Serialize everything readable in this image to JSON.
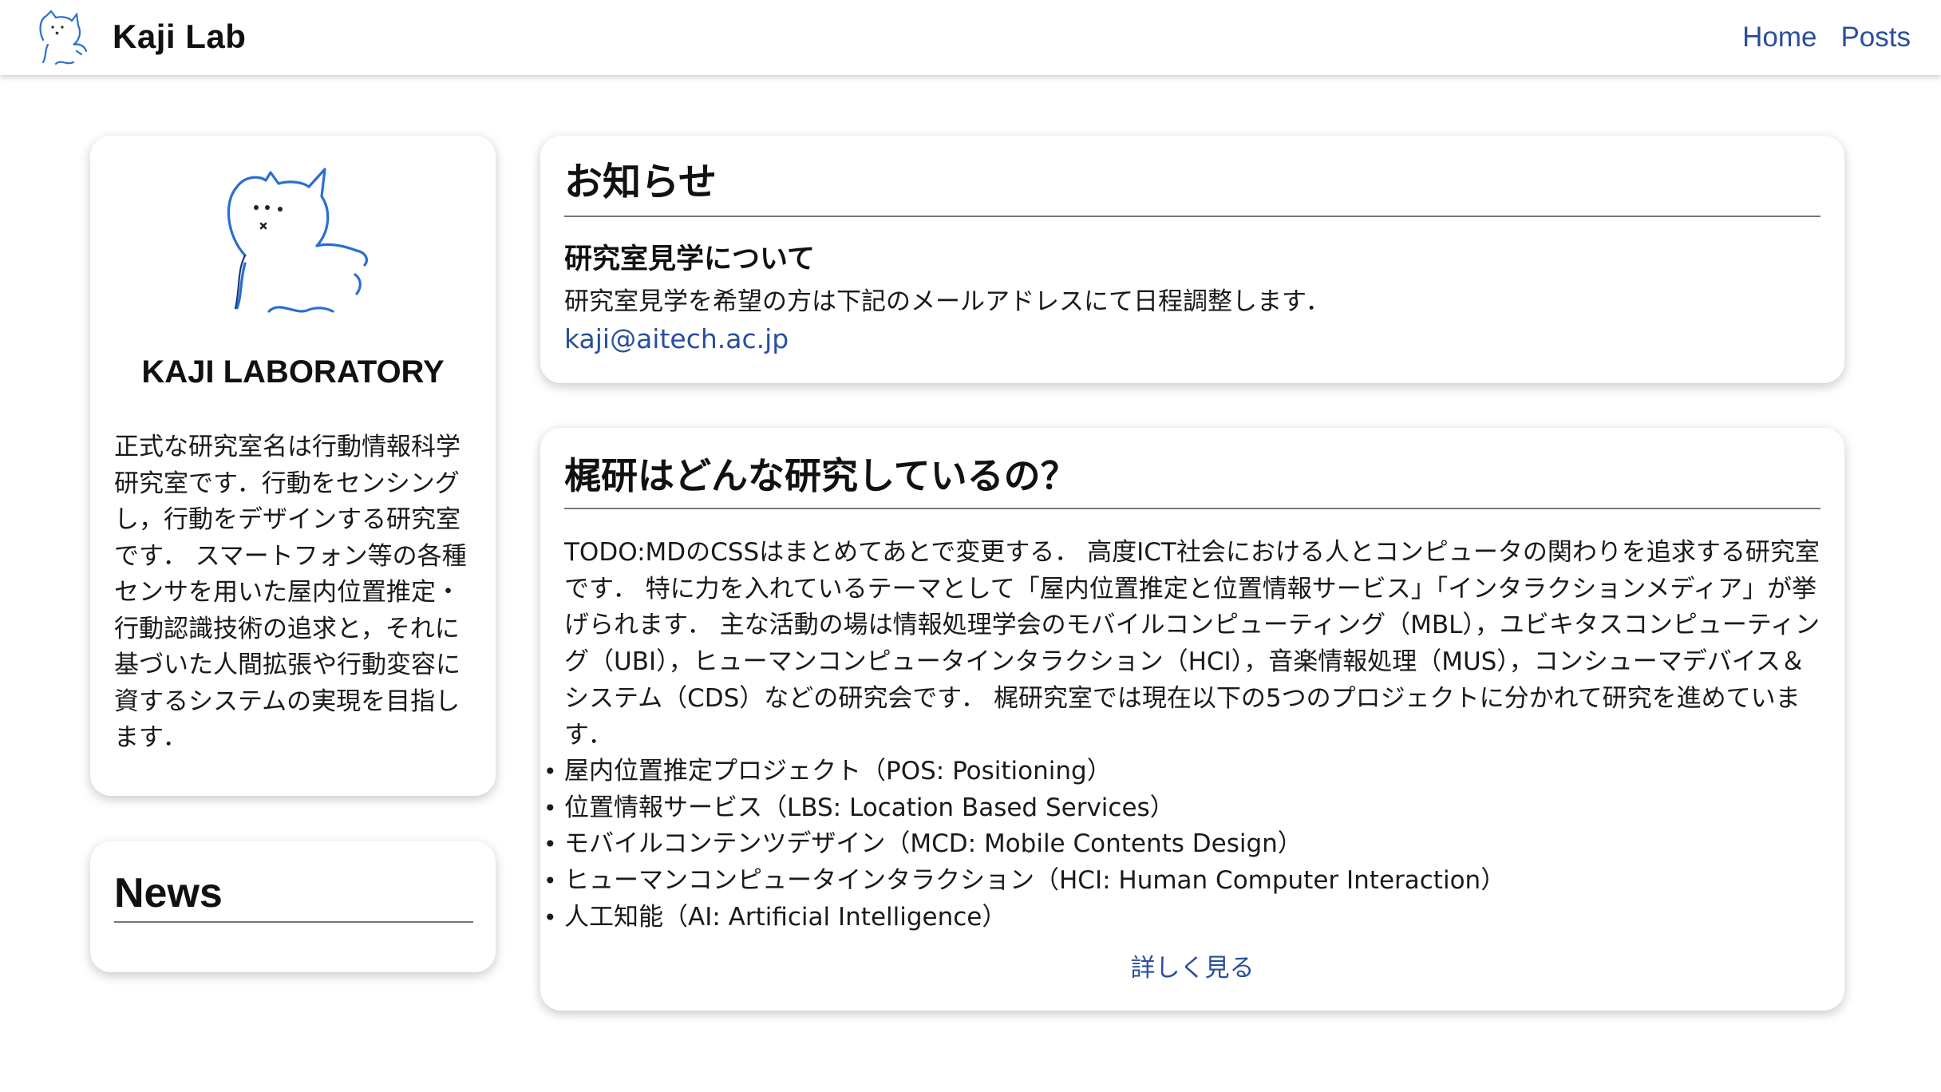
{
  "navbar": {
    "brand_title": "Kaji Lab",
    "logo_icon": "cat-drawing-icon",
    "links": [
      {
        "label": "Home"
      },
      {
        "label": "Posts"
      }
    ],
    "link_color": "#2a4e9e"
  },
  "profile": {
    "avatar_icon": "cat-drawing-icon",
    "title": "KAJI LABORATORY",
    "description": "正式な研究室名は行動情報科学研究室です．行動をセンシングし，行動をデザインする研究室です． スマートフォン等の各種センサを用いた屋内位置推定・行動認識技術の追求と，それに基づいた人間拡張や行動変容に資するシステムの実現を目指します．"
  },
  "news": {
    "heading": "News"
  },
  "notice": {
    "heading": "お知らせ",
    "item_title": "研究室見学について",
    "item_body": "研究室見学を希望の方は下記のメールアドレスにて日程調整します．",
    "email": "kaji@aitech.ac.jp"
  },
  "research": {
    "heading": "梶研はどんな研究しているの？",
    "body": "TODO:MDのCSSはまとめてあとで変更する． 高度ICT社会における人とコンピュータの関わりを追求する研究室です． 特に力を入れているテーマとして「屋内位置推定と位置情報サービス」「インタラクションメディア」が挙げられます． 主な活動の場は情報処理学会のモバイルコンピューティング（MBL），ユビキタスコンピューティング（UBI），ヒューマンコンピュータインタラクション（HCI），音楽情報処理（MUS），コンシューマデバイス＆システム（CDS）などの研究会です． 梶研究室では現在以下の5つのプロジェクトに分かれて研究を進めています．",
    "projects": [
      "屋内位置推定プロジェクト（POS: Positioning）",
      "位置情報サービス（LBS: Location Based Services）",
      "モバイルコンテンツデザイン（MCD: Mobile Contents Design）",
      "ヒューマンコンピュータインタラクション（HCI: Human Computer Interaction）",
      "人工知能（AI: Artificial Intelligence）"
    ],
    "bullet": "•",
    "more_label": "詳しく見る"
  }
}
